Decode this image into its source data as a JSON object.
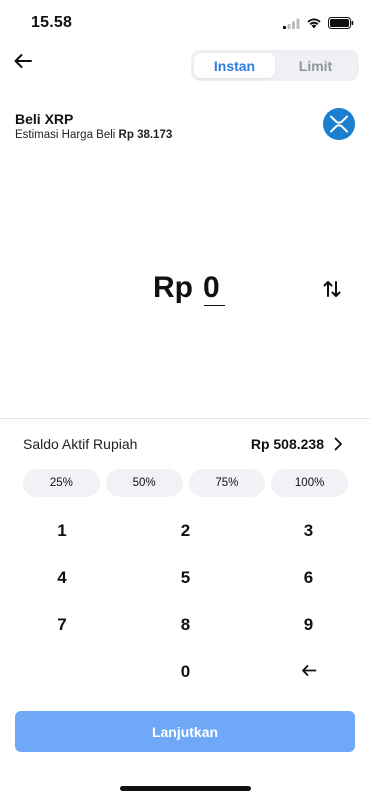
{
  "status_bar": {
    "time": "15.58",
    "icons": [
      "signal-icon",
      "wifi-icon",
      "battery-icon"
    ]
  },
  "header": {
    "back_icon": "arrow-left-icon",
    "tabs": [
      {
        "label": "Instan",
        "active": true
      },
      {
        "label": "Limit",
        "active": false
      }
    ]
  },
  "asset": {
    "title": "Beli XRP",
    "estimate_label": "Estimasi Harga Beli",
    "estimate_value": "Rp 38.173",
    "logo_icon": "xrp-logo-icon"
  },
  "amount": {
    "prefix": "Rp",
    "value": "0",
    "swap_icon": "swap-vertical-icon"
  },
  "balance": {
    "label": "Saldo Aktif Rupiah",
    "value": "Rp 508.238",
    "chevron_icon": "chevron-right-icon"
  },
  "percent_options": [
    "25%",
    "50%",
    "75%",
    "100%"
  ],
  "keypad": {
    "keys": [
      "1",
      "2",
      "3",
      "4",
      "5",
      "6",
      "7",
      "8",
      "9",
      "",
      "0",
      "⌫"
    ],
    "backspace_icon": "backspace-arrow-icon"
  },
  "submit": {
    "label": "Lanjutkan"
  },
  "colors": {
    "accent": "#2f7de1",
    "button": "#6ea8f7",
    "coin": "#1b7fd0"
  }
}
